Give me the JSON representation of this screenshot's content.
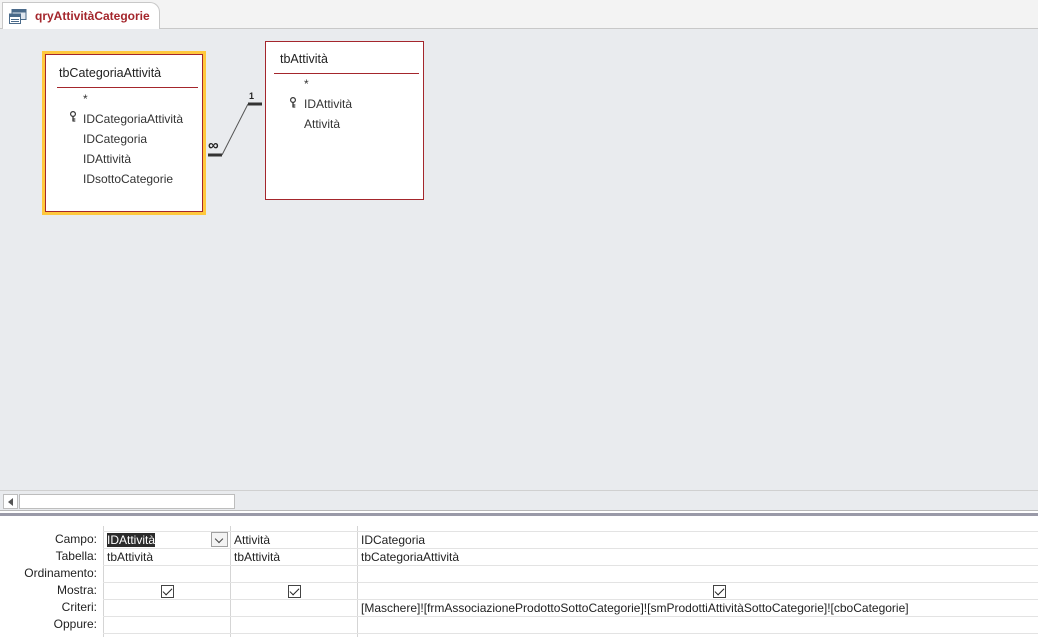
{
  "tab": {
    "title": "qryAttivitàCategorie",
    "icon": "query-icon"
  },
  "tables": [
    {
      "title": "tbCategoriaAttività",
      "fields": [
        "*",
        "IDCategoriaAttività",
        "IDCategoria",
        "IDAttività",
        "IDsottoCategorie"
      ],
      "key_field": "IDCategoriaAttività",
      "selected": true
    },
    {
      "title": "tbAttività",
      "fields": [
        "*",
        "IDAttività",
        "Attività"
      ],
      "key_field": "IDAttività",
      "selected": false
    }
  ],
  "relationship": {
    "one_label": "1",
    "many_label": "∞"
  },
  "grid": {
    "row_labels": [
      "Campo:",
      "Tabella:",
      "Ordinamento:",
      "Mostra:",
      "Criteri:",
      "Oppure:"
    ],
    "columns": [
      {
        "campo": "IDAttività",
        "tabella": "tbAttività",
        "ordinamento": "",
        "mostra": true,
        "criteri": "",
        "oppure": ""
      },
      {
        "campo": "Attività",
        "tabella": "tbAttività",
        "ordinamento": "",
        "mostra": true,
        "criteri": "",
        "oppure": ""
      },
      {
        "campo": "IDCategoria",
        "tabella": "tbCategoriaAttività",
        "ordinamento": "",
        "mostra": true,
        "criteri": "[Maschere]![frmAssociazioneProdottoSottoCategorie]![smProdottiAttivitàSottoCategorie]![cboCategorie]",
        "oppure": ""
      }
    ]
  },
  "colors": {
    "accent": "#a4262c",
    "selection_border": "#ffc83d",
    "canvas": "#e9ebee"
  }
}
